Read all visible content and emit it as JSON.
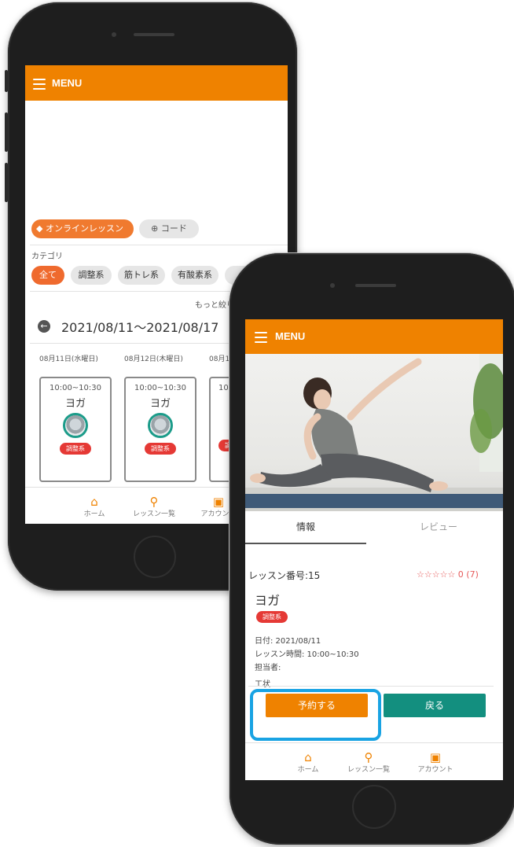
{
  "colors": {
    "accent": "#ef8200",
    "teal": "#138f7f",
    "tag_red": "#e53935",
    "highlight": "#19a3e3"
  },
  "left_phone": {
    "menu_label": "MENU",
    "filters": {
      "online": "オンラインレッスン",
      "code": "コード"
    },
    "category_label": "カテゴリ",
    "categories": [
      "全て",
      "調整系",
      "筋トレ系",
      "有酸素系"
    ],
    "more_filter": "もっと絞り",
    "date_range": "2021/08/11～2021/08/17",
    "days": [
      "08月11日(水曜日)",
      "08月12日(木曜日)",
      "08月1"
    ],
    "cards": [
      {
        "time": "10:00~10:30",
        "title": "ヨガ",
        "tag": "調整系"
      },
      {
        "time": "10:00~10:30",
        "title": "ヨガ",
        "tag": "調整系"
      },
      {
        "time": "10:0",
        "title": "",
        "tag": "調"
      }
    ],
    "nav": [
      {
        "label": "ホーム",
        "icon": "home-icon"
      },
      {
        "label": "レッスン一覧",
        "icon": "search-icon"
      },
      {
        "label": "アカウント",
        "icon": "account-icon"
      }
    ]
  },
  "right_phone": {
    "menu_label": "MENU",
    "tabs": [
      "情報",
      "レビュー"
    ],
    "lesson_number": "レッスン番号:15",
    "rating_text": "☆☆☆☆☆ 0 (7)",
    "rating_value": 0,
    "title": "ヨガ",
    "tag": "調整系",
    "date_line": "日付: 2021/08/11",
    "time_line": "レッスン時間: 10:00~10:30",
    "instructor_label": "担当者:",
    "partial_label": "工状",
    "reserve_button": "予約する",
    "back_button": "戻る",
    "nav": [
      {
        "label": "ホーム",
        "icon": "home-icon"
      },
      {
        "label": "レッスン一覧",
        "icon": "search-icon"
      },
      {
        "label": "アカウント",
        "icon": "account-icon"
      }
    ]
  }
}
